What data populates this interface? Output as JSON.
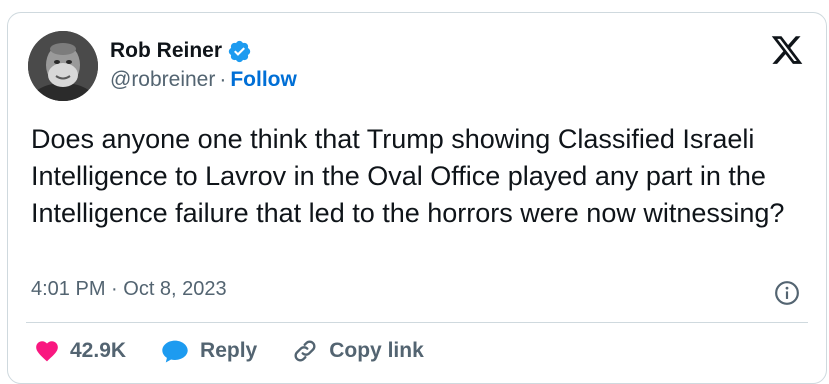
{
  "author": {
    "name": "Rob Reiner",
    "handle": "@robreiner",
    "separator": "·",
    "follow_label": "Follow",
    "verified": true,
    "avatar_icon": "user-avatar-photo",
    "verified_icon": "verified-badge-icon"
  },
  "brand": {
    "logo_icon": "x-logo-icon",
    "accent_color": "#1d9bf0",
    "like_color": "#f91880"
  },
  "tweet": {
    "text": "Does anyone one think that Trump showing Classified Israeli Intelligence to Lavrov in the Oval Office played any part in the Intelligence failure that led to the horrors were now witnessing?",
    "timestamp": "4:01 PM · Oct 8, 2023"
  },
  "actions": {
    "like_count": "42.9K",
    "reply_label": "Reply",
    "copy_link_label": "Copy link",
    "like_icon": "heart-icon",
    "reply_icon": "speech-bubble-icon",
    "copy_link_icon": "link-icon",
    "info_icon": "info-icon"
  }
}
